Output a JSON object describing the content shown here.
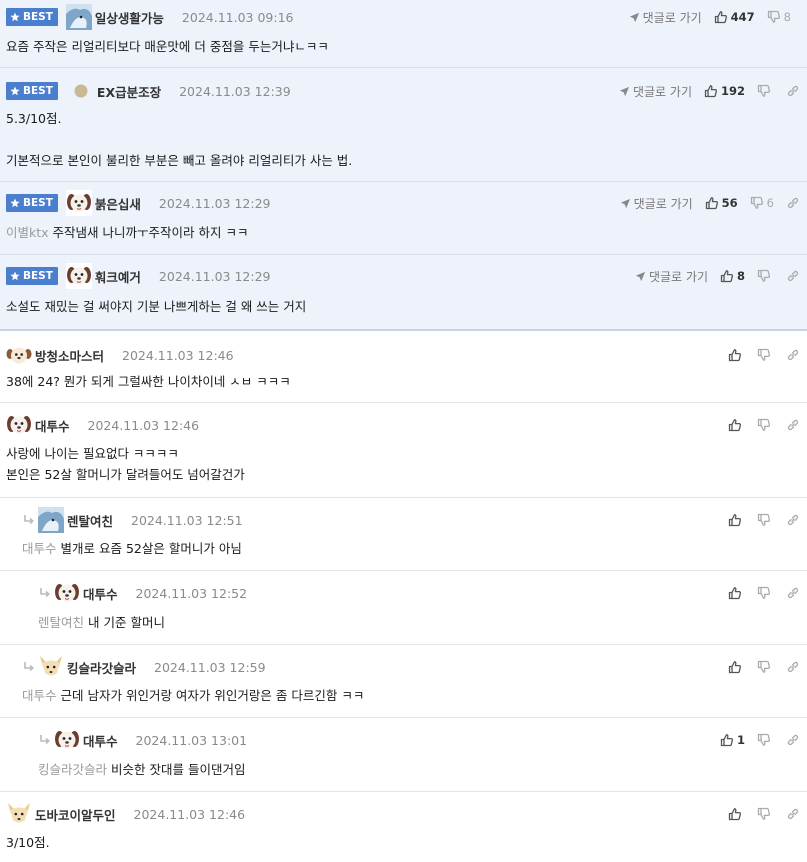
{
  "best_label": "BEST",
  "reply_label": "댓글로 가기",
  "comments": [
    {
      "nick": "일상생활가능",
      "date": "2024.11.03 09:16",
      "body": [
        "요즘 주작은 리얼리티보다 매운맛에 더 중점을 두는거냐ㄴㅋㅋ"
      ],
      "up": "447",
      "down": "8"
    },
    {
      "nick": "EX급분조장",
      "date": "2024.11.03 12:39",
      "body": [
        "5.3/10점.",
        "",
        "기본적으로 본인이 불리한 부분은 빼고 올려야 리얼리티가 사는 법."
      ],
      "up": "192",
      "down": ""
    },
    {
      "nick": "붉은십새",
      "date": "2024.11.03 12:29",
      "mention": "이별ktx",
      "body": [
        "주작냄새 나니까ㅜ주작이라 하지 ㅋㅋ"
      ],
      "up": "56",
      "down": "6"
    },
    {
      "nick": "훠크예거",
      "date": "2024.11.03 12:29",
      "body": [
        "소설도 재밌는 걸 써야지 기분 나쁘게하는 걸 왜 쓰는 거지"
      ],
      "up": "8",
      "down": ""
    },
    {
      "nick": "방청소마스터",
      "date": "2024.11.03 12:46",
      "body": [
        "38에 24? 뭔가 되게 그럴싸한 나이차이네 ㅅㅂ ㅋㅋㅋ"
      ],
      "up": "",
      "down": ""
    },
    {
      "nick": "대투수",
      "date": "2024.11.03 12:46",
      "body": [
        "사랑에 나이는 필요없다 ㅋㅋㅋㅋ",
        "본인은 52살 할머니가 달려들어도 넘어갈건가"
      ],
      "up": "",
      "down": ""
    },
    {
      "nick": "렌탈여친",
      "date": "2024.11.03 12:51",
      "mention": "대투수",
      "body": [
        "별개로 요즘 52살은 할머니가 아님"
      ],
      "up": "",
      "down": ""
    },
    {
      "nick": "대투수",
      "date": "2024.11.03 12:52",
      "mention": "렌탈여친",
      "body": [
        "내 기준 할머니"
      ],
      "up": "",
      "down": ""
    },
    {
      "nick": "킹슬라갓슬라",
      "date": "2024.11.03 12:59",
      "mention": "대투수",
      "body": [
        "근데 남자가 위인거랑 여자가 위인거랑은 좀 다르긴함 ㅋㅋ"
      ],
      "up": "",
      "down": ""
    },
    {
      "nick": "대투수",
      "date": "2024.11.03 13:01",
      "mention": "킹슬라갓슬라",
      "body": [
        "비슷한 잣대를 들이댄거임"
      ],
      "up": "1",
      "down": ""
    },
    {
      "nick": "도바코이알두인",
      "date": "2024.11.03 12:46",
      "body": [
        "3/10점."
      ],
      "up": "",
      "down": ""
    }
  ],
  "colors": {
    "best_bg": "#eef3fb",
    "badge": "#4a7fd0"
  },
  "icons": [
    "star-icon",
    "reply-arrow-icon",
    "send-icon",
    "thumbs-up-icon",
    "thumbs-down-icon",
    "link-icon",
    "avatar"
  ]
}
